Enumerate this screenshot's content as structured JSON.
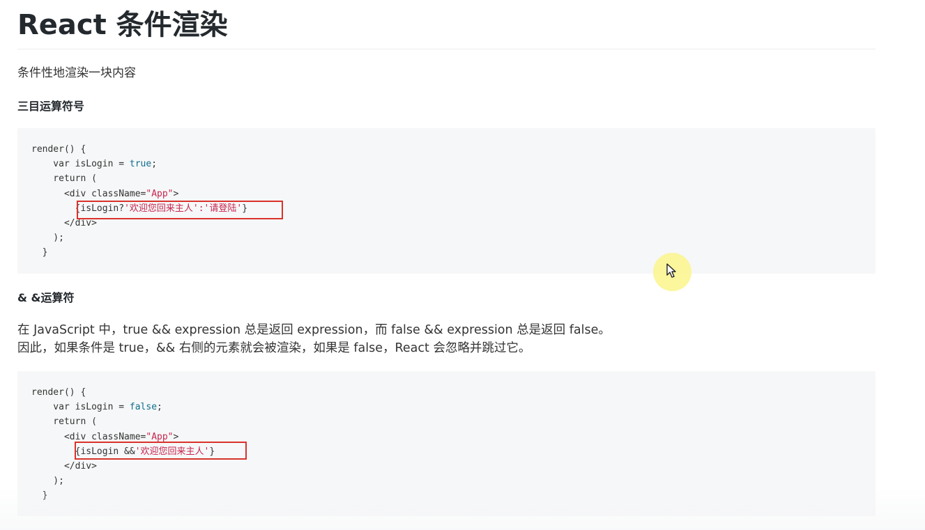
{
  "document": {
    "title": "React 条件渲染",
    "intro": "条件性地渲染一块内容",
    "section1": {
      "heading": "三目运算符号",
      "code": {
        "line1": "render() {",
        "line2_prefix": "    var isLogin = ",
        "line2_bool": "true",
        "line2_suffix": ";",
        "line3": "    return (",
        "line4_prefix": "      <div className=",
        "line4_str": "\"App\"",
        "line4_suffix": ">",
        "line5_prefix": "        {isLogin?",
        "line5_str": "'欢迎您回来主人':'请登陆'",
        "line5_suffix": "}",
        "line6": "      </div>",
        "line7": "    );",
        "line8": "  }"
      }
    },
    "section2": {
      "heading": "& &运算符",
      "para_line1": "在 JavaScript 中，true && expression 总是返回 expression，而 false && expression 总是返回 false。",
      "para_line2": "因此，如果条件是 true，&& 右侧的元素就会被渲染，如果是 false，React 会忽略并跳过它。",
      "code": {
        "line1": "render() {",
        "line2_prefix": "    var isLogin = ",
        "line2_bool": "false",
        "line2_suffix": ";",
        "line3": "    return (",
        "line4_prefix": "      <div className=",
        "line4_str": "\"App\"",
        "line4_suffix": ">",
        "line5_prefix": "        {isLogin &&",
        "line5_str": "'欢迎您回来主人'",
        "line5_suffix": "}",
        "line6": "      </div>",
        "line7": "    );",
        "line8": "  }"
      }
    }
  },
  "annotations": {
    "highlight_color": "#d9322b",
    "cursor_halo_color": "#fcf48c"
  },
  "icons": {
    "cursor": "mouse-pointer-icon"
  }
}
